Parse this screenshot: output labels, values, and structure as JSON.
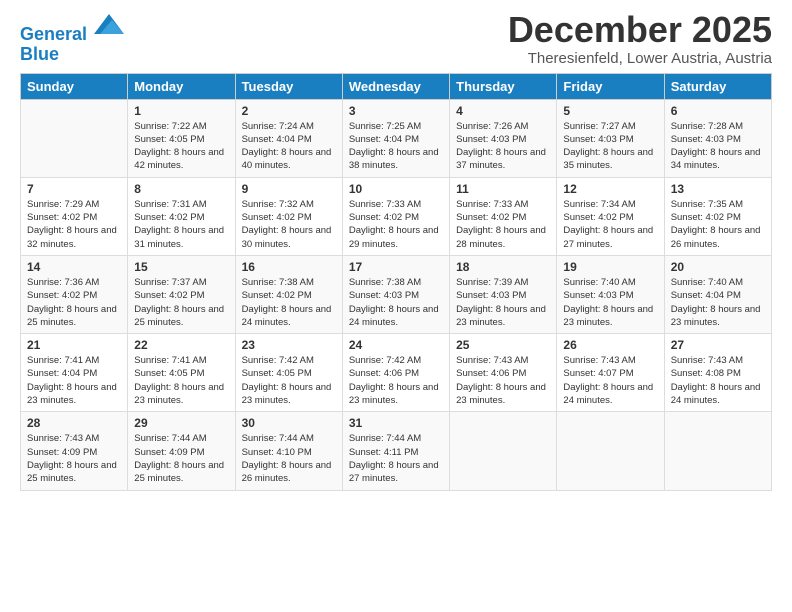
{
  "logo": {
    "line1": "General",
    "line2": "Blue"
  },
  "title": "December 2025",
  "subtitle": "Theresienfeld, Lower Austria, Austria",
  "days_of_week": [
    "Sunday",
    "Monday",
    "Tuesday",
    "Wednesday",
    "Thursday",
    "Friday",
    "Saturday"
  ],
  "weeks": [
    [
      {
        "day": "",
        "sunrise": "",
        "sunset": "",
        "daylight": ""
      },
      {
        "day": "1",
        "sunrise": "Sunrise: 7:22 AM",
        "sunset": "Sunset: 4:05 PM",
        "daylight": "Daylight: 8 hours and 42 minutes."
      },
      {
        "day": "2",
        "sunrise": "Sunrise: 7:24 AM",
        "sunset": "Sunset: 4:04 PM",
        "daylight": "Daylight: 8 hours and 40 minutes."
      },
      {
        "day": "3",
        "sunrise": "Sunrise: 7:25 AM",
        "sunset": "Sunset: 4:04 PM",
        "daylight": "Daylight: 8 hours and 38 minutes."
      },
      {
        "day": "4",
        "sunrise": "Sunrise: 7:26 AM",
        "sunset": "Sunset: 4:03 PM",
        "daylight": "Daylight: 8 hours and 37 minutes."
      },
      {
        "day": "5",
        "sunrise": "Sunrise: 7:27 AM",
        "sunset": "Sunset: 4:03 PM",
        "daylight": "Daylight: 8 hours and 35 minutes."
      },
      {
        "day": "6",
        "sunrise": "Sunrise: 7:28 AM",
        "sunset": "Sunset: 4:03 PM",
        "daylight": "Daylight: 8 hours and 34 minutes."
      }
    ],
    [
      {
        "day": "7",
        "sunrise": "Sunrise: 7:29 AM",
        "sunset": "Sunset: 4:02 PM",
        "daylight": "Daylight: 8 hours and 32 minutes."
      },
      {
        "day": "8",
        "sunrise": "Sunrise: 7:31 AM",
        "sunset": "Sunset: 4:02 PM",
        "daylight": "Daylight: 8 hours and 31 minutes."
      },
      {
        "day": "9",
        "sunrise": "Sunrise: 7:32 AM",
        "sunset": "Sunset: 4:02 PM",
        "daylight": "Daylight: 8 hours and 30 minutes."
      },
      {
        "day": "10",
        "sunrise": "Sunrise: 7:33 AM",
        "sunset": "Sunset: 4:02 PM",
        "daylight": "Daylight: 8 hours and 29 minutes."
      },
      {
        "day": "11",
        "sunrise": "Sunrise: 7:33 AM",
        "sunset": "Sunset: 4:02 PM",
        "daylight": "Daylight: 8 hours and 28 minutes."
      },
      {
        "day": "12",
        "sunrise": "Sunrise: 7:34 AM",
        "sunset": "Sunset: 4:02 PM",
        "daylight": "Daylight: 8 hours and 27 minutes."
      },
      {
        "day": "13",
        "sunrise": "Sunrise: 7:35 AM",
        "sunset": "Sunset: 4:02 PM",
        "daylight": "Daylight: 8 hours and 26 minutes."
      }
    ],
    [
      {
        "day": "14",
        "sunrise": "Sunrise: 7:36 AM",
        "sunset": "Sunset: 4:02 PM",
        "daylight": "Daylight: 8 hours and 25 minutes."
      },
      {
        "day": "15",
        "sunrise": "Sunrise: 7:37 AM",
        "sunset": "Sunset: 4:02 PM",
        "daylight": "Daylight: 8 hours and 25 minutes."
      },
      {
        "day": "16",
        "sunrise": "Sunrise: 7:38 AM",
        "sunset": "Sunset: 4:02 PM",
        "daylight": "Daylight: 8 hours and 24 minutes."
      },
      {
        "day": "17",
        "sunrise": "Sunrise: 7:38 AM",
        "sunset": "Sunset: 4:03 PM",
        "daylight": "Daylight: 8 hours and 24 minutes."
      },
      {
        "day": "18",
        "sunrise": "Sunrise: 7:39 AM",
        "sunset": "Sunset: 4:03 PM",
        "daylight": "Daylight: 8 hours and 23 minutes."
      },
      {
        "day": "19",
        "sunrise": "Sunrise: 7:40 AM",
        "sunset": "Sunset: 4:03 PM",
        "daylight": "Daylight: 8 hours and 23 minutes."
      },
      {
        "day": "20",
        "sunrise": "Sunrise: 7:40 AM",
        "sunset": "Sunset: 4:04 PM",
        "daylight": "Daylight: 8 hours and 23 minutes."
      }
    ],
    [
      {
        "day": "21",
        "sunrise": "Sunrise: 7:41 AM",
        "sunset": "Sunset: 4:04 PM",
        "daylight": "Daylight: 8 hours and 23 minutes."
      },
      {
        "day": "22",
        "sunrise": "Sunrise: 7:41 AM",
        "sunset": "Sunset: 4:05 PM",
        "daylight": "Daylight: 8 hours and 23 minutes."
      },
      {
        "day": "23",
        "sunrise": "Sunrise: 7:42 AM",
        "sunset": "Sunset: 4:05 PM",
        "daylight": "Daylight: 8 hours and 23 minutes."
      },
      {
        "day": "24",
        "sunrise": "Sunrise: 7:42 AM",
        "sunset": "Sunset: 4:06 PM",
        "daylight": "Daylight: 8 hours and 23 minutes."
      },
      {
        "day": "25",
        "sunrise": "Sunrise: 7:43 AM",
        "sunset": "Sunset: 4:06 PM",
        "daylight": "Daylight: 8 hours and 23 minutes."
      },
      {
        "day": "26",
        "sunrise": "Sunrise: 7:43 AM",
        "sunset": "Sunset: 4:07 PM",
        "daylight": "Daylight: 8 hours and 24 minutes."
      },
      {
        "day": "27",
        "sunrise": "Sunrise: 7:43 AM",
        "sunset": "Sunset: 4:08 PM",
        "daylight": "Daylight: 8 hours and 24 minutes."
      }
    ],
    [
      {
        "day": "28",
        "sunrise": "Sunrise: 7:43 AM",
        "sunset": "Sunset: 4:09 PM",
        "daylight": "Daylight: 8 hours and 25 minutes."
      },
      {
        "day": "29",
        "sunrise": "Sunrise: 7:44 AM",
        "sunset": "Sunset: 4:09 PM",
        "daylight": "Daylight: 8 hours and 25 minutes."
      },
      {
        "day": "30",
        "sunrise": "Sunrise: 7:44 AM",
        "sunset": "Sunset: 4:10 PM",
        "daylight": "Daylight: 8 hours and 26 minutes."
      },
      {
        "day": "31",
        "sunrise": "Sunrise: 7:44 AM",
        "sunset": "Sunset: 4:11 PM",
        "daylight": "Daylight: 8 hours and 27 minutes."
      },
      {
        "day": "",
        "sunrise": "",
        "sunset": "",
        "daylight": ""
      },
      {
        "day": "",
        "sunrise": "",
        "sunset": "",
        "daylight": ""
      },
      {
        "day": "",
        "sunrise": "",
        "sunset": "",
        "daylight": ""
      }
    ]
  ]
}
